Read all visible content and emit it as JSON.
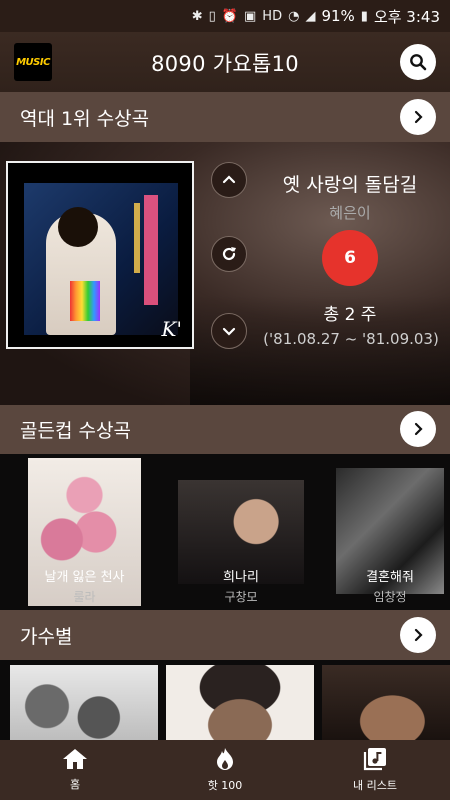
{
  "status_bar": {
    "battery": "91%",
    "time": "오후 3:43",
    "icons": [
      "bluetooth-icon",
      "vibrate-icon",
      "alarm-icon",
      "nfc-icon",
      "hd-icon",
      "wifi-icon",
      "signal-icon",
      "battery-icon"
    ],
    "hd_label": "HD"
  },
  "header": {
    "logo_text": "MUSIC",
    "title": "8090 가요톱10",
    "search_icon": "search-icon"
  },
  "top_hits": {
    "section_label": "역대 1위 수상곡",
    "song_title": "옛 사랑의 돌담길",
    "artist": "혜은이",
    "weeks_badge": "6",
    "total_weeks": "총 2 주",
    "period": "('81.08.27 ~ '81.09.03)",
    "album_sig": "K'"
  },
  "golden_cup": {
    "section_label": "골든컵 수상곡",
    "items": [
      {
        "title": "날개 잃은 천사",
        "artist": "룰라"
      },
      {
        "title": "희나리",
        "artist": "구창모"
      },
      {
        "title": "결혼해줘",
        "artist": "임창정"
      }
    ]
  },
  "singers": {
    "section_label": "가수별"
  },
  "bottom_nav": {
    "items": [
      {
        "label": "홈",
        "icon": "home-icon"
      },
      {
        "label": "핫 100",
        "icon": "flame-icon"
      },
      {
        "label": "내 리스트",
        "icon": "music-list-icon"
      }
    ]
  },
  "colors": {
    "header_bg": "#3b2a22",
    "section_bg": "#5a473e",
    "badge_red": "#e6332c",
    "nav_bg": "#3a2a23"
  }
}
